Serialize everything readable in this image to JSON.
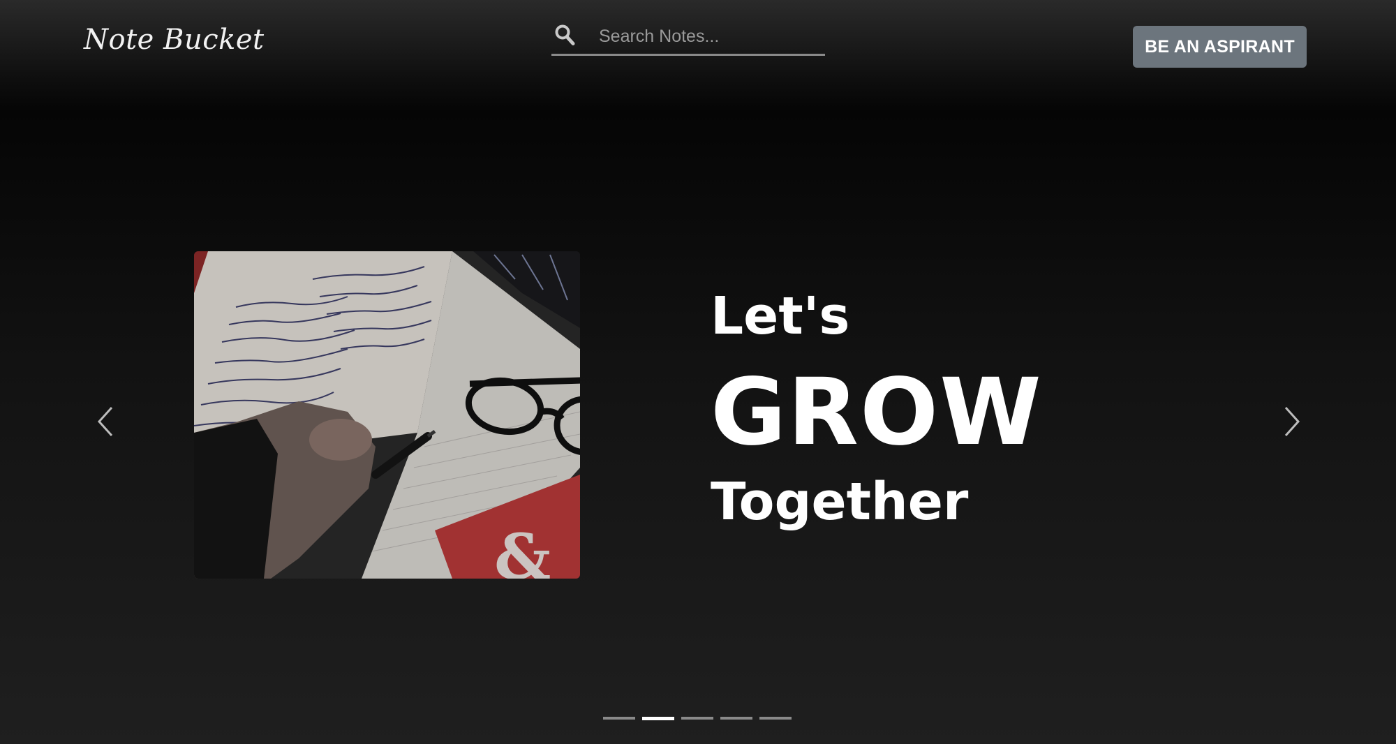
{
  "navbar": {
    "brand": "Note Bucket",
    "search": {
      "placeholder": "Search Notes...",
      "value": "",
      "icon": "search-icon"
    },
    "cta_label": "BE AN ASPIRANT"
  },
  "hero": {
    "line1": "Let's",
    "line2": "GROW",
    "line3": "Together"
  },
  "carousel": {
    "prev_icon": "chevron-left-icon",
    "next_icon": "chevron-right-icon",
    "slide_count": 5,
    "active_index": 1
  },
  "colors": {
    "cta_background": "#6c757d",
    "text": "#ffffff",
    "indicator_inactive": "#8a8a8a",
    "indicator_active": "#ffffff"
  }
}
